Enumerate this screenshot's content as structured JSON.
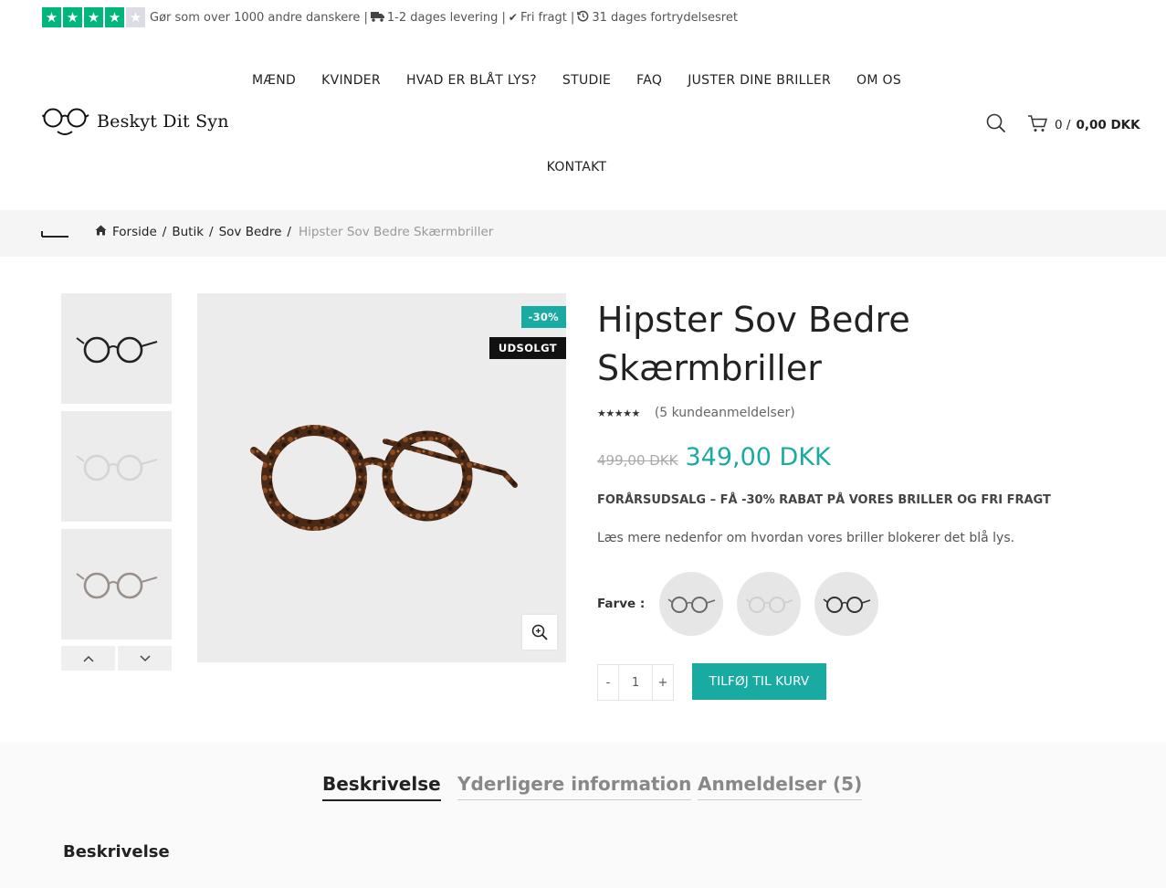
{
  "topbar": {
    "trust_text": "Gør som over 1000 andre danskere |",
    "delivery_text": "1-2 dages levering |",
    "shipping_text": "Fri fragt |",
    "return_text": "31 dages fortrydelsesret",
    "rating_stars": 4
  },
  "header": {
    "logo_text": "Beskyt Dit Syn",
    "nav": [
      "MÆND",
      "KVINDER",
      "HVAD ER BLÅT LYS?",
      "STUDIE",
      "FAQ",
      "JUSTER DINE BRILLER",
      "OM OS"
    ],
    "nav_row2": "KONTAKT",
    "cart_count": "0 /",
    "cart_total": "0,00 DKK"
  },
  "breadcrumb": {
    "items": [
      "Forside",
      "Butik",
      "Sov Bedre"
    ],
    "separator": "/",
    "current": "Hipster Sov Bedre Skærmbriller"
  },
  "product": {
    "badge_sale": "-30%",
    "badge_sold": "UDSOLGT",
    "title": "Hipster Sov Bedre Skærmbriller",
    "review_text": "(5 kundeanmeldelser)",
    "rating": 5,
    "old_price": "499,00 DKK",
    "new_price": "349,00 DKK",
    "promo": "FORÅRSUDSALG – FÅ -30% RABAT PÅ VORES BRILLER OG FRI FRAGT",
    "description": "Læs mere nedenfor om hvordan vores briller blokerer det blå lys.",
    "color_label": "Farve :",
    "quantity": "1",
    "qty_minus": "-",
    "qty_plus": "+",
    "add_to_cart": "TILFØJ TIL KURV"
  },
  "tabs": {
    "items": [
      "Beskrivelse",
      "Yderligere information",
      "Anmeldelser (5)"
    ],
    "heading": "Beskrivelse"
  },
  "colors": {
    "accent": "#19aaa2",
    "trustpilot": "#00b67a"
  }
}
